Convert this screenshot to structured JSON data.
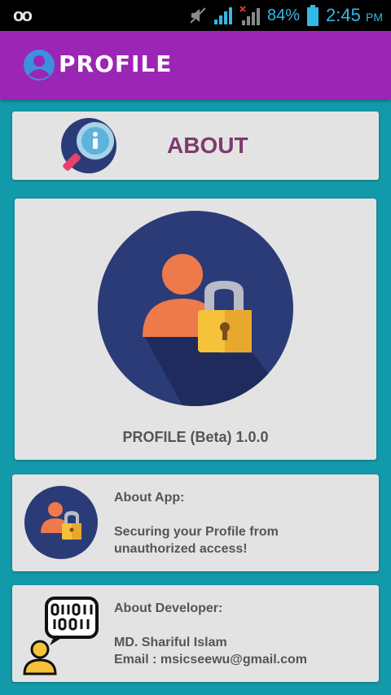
{
  "status_bar": {
    "left_symbol": "oo",
    "battery": "84%",
    "time": "2:45",
    "ampm": "PM"
  },
  "app_bar": {
    "title": "PROFILE",
    "icon": "user-circle-icon"
  },
  "about_card": {
    "label": "ABOUT",
    "icon": "info-search-icon"
  },
  "main_card": {
    "logo": "user-lock-icon",
    "version_text": "PROFILE (Beta) 1.0.0"
  },
  "about_app": {
    "heading": "About App:",
    "description_line1": "Securing your Profile from",
    "description_line2": "unauthorized access!",
    "icon": "user-lock-icon"
  },
  "about_developer": {
    "heading": "About Developer:",
    "name": "MD. Shariful Islam",
    "email": "Email : msicseewu@gmail.com",
    "icon": "developer-binary-icon"
  },
  "colors": {
    "background": "#139aaa",
    "app_bar": "#9b25b5",
    "card": "#e3e3e3",
    "about_label": "#7e3a6f",
    "logo_circle": "#2b3b78",
    "user_orange": "#ee7a4c",
    "lock_yellow": "#f5c23a"
  }
}
